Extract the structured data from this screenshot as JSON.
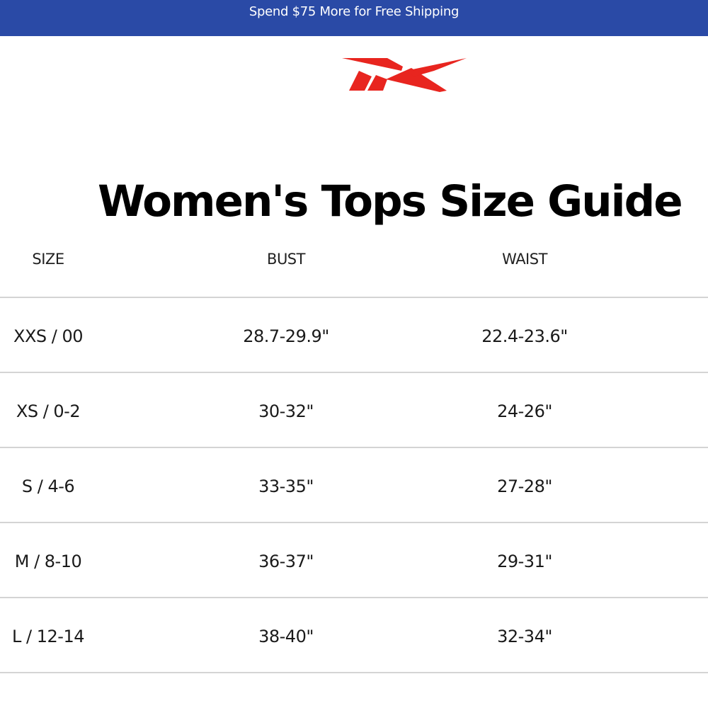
{
  "promo": {
    "text": "Spend $75 More for Free Shipping"
  },
  "brand": {
    "logo_icon": "reebok-vector-logo",
    "color": "#e8251f"
  },
  "page": {
    "title": "Women's Tops Size Guide"
  },
  "table": {
    "headers": [
      "SIZE",
      "BUST",
      "WAIST"
    ],
    "rows": [
      [
        "XXS / 00",
        "28.7-29.9\"",
        "22.4-23.6\""
      ],
      [
        "XS / 0-2",
        "30-32\"",
        "24-26\""
      ],
      [
        "S / 4-6",
        "33-35\"",
        "27-28\""
      ],
      [
        "M / 8-10",
        "36-37\"",
        "29-31\""
      ],
      [
        "L / 12-14",
        "38-40\"",
        "32-34\""
      ]
    ]
  },
  "colors": {
    "promo_bg": "#2a4aa6",
    "divider": "#d4d4d4",
    "logo_red": "#e8251f"
  }
}
